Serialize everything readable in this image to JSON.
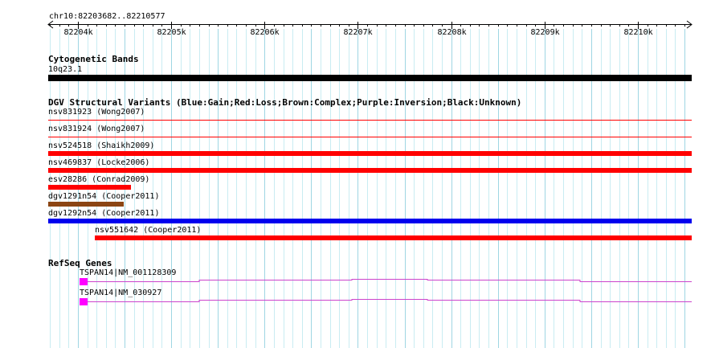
{
  "ruler": {
    "location": "chr10:82203682..82210577",
    "ticks": [
      {
        "label": "82204k",
        "pos": 82204000
      },
      {
        "label": "82205k",
        "pos": 82205000
      },
      {
        "label": "82206k",
        "pos": 82206000
      },
      {
        "label": "82207k",
        "pos": 82207000
      },
      {
        "label": "82208k",
        "pos": 82208000
      },
      {
        "label": "82209k",
        "pos": 82209000
      },
      {
        "label": "82210k",
        "pos": 82210000
      }
    ],
    "start": 82203682,
    "end": 82210577
  },
  "cytobands": {
    "title": "Cytogenetic Bands",
    "band_label": "10q23.1",
    "band_color": "#000000"
  },
  "dgv": {
    "title": "DGV Structural Variants (Blue:Gain;Red:Loss;Brown:Complex;Purple:Inversion;Black:Unknown)",
    "features": [
      {
        "label": "nsv831923 (Wong2007)",
        "start": 82203682,
        "end": 82210577,
        "color": "#ff0000",
        "style": "thin"
      },
      {
        "label": "nsv831924 (Wong2007)",
        "start": 82203682,
        "end": 82210577,
        "color": "#ff0000",
        "style": "thin"
      },
      {
        "label": "nsv524518 (Shaikh2009)",
        "start": 82203682,
        "end": 82210577,
        "color": "#ff0000",
        "style": "bar"
      },
      {
        "label": "nsv469837 (Locke2006)",
        "start": 82203682,
        "end": 82210577,
        "color": "#ff0000",
        "style": "bar"
      },
      {
        "label": "esv28286 (Conrad2009)",
        "start": 82203682,
        "end": 82204570,
        "color": "#ff0000",
        "style": "bar"
      },
      {
        "label": "dgv1291n54 (Cooper2011)",
        "start": 82203682,
        "end": 82204490,
        "color": "#8b4513",
        "style": "bar"
      },
      {
        "label": "dgv1292n54 (Cooper2011)",
        "start": 82203682,
        "end": 82210577,
        "color": "#0000ee",
        "style": "bar"
      },
      {
        "label": "nsv551642 (Cooper2011)",
        "start": 82204180,
        "end": 82210577,
        "color": "#ff0000",
        "style": "bar"
      }
    ]
  },
  "refseq": {
    "title": "RefSeq Genes",
    "gene_color": "#cc44cc",
    "exon_color": "#ff00ff",
    "genes": [
      {
        "label": "TSPAN14|NM_001128309",
        "start": 82204020,
        "end": 82210577
      },
      {
        "label": "TSPAN14|NM_030927",
        "start": 82204020,
        "end": 82210577
      }
    ]
  },
  "colors": {
    "grid_major": "#9fd6e3",
    "grid_minor": "#c9ecf2",
    "ruler": "#000000"
  }
}
